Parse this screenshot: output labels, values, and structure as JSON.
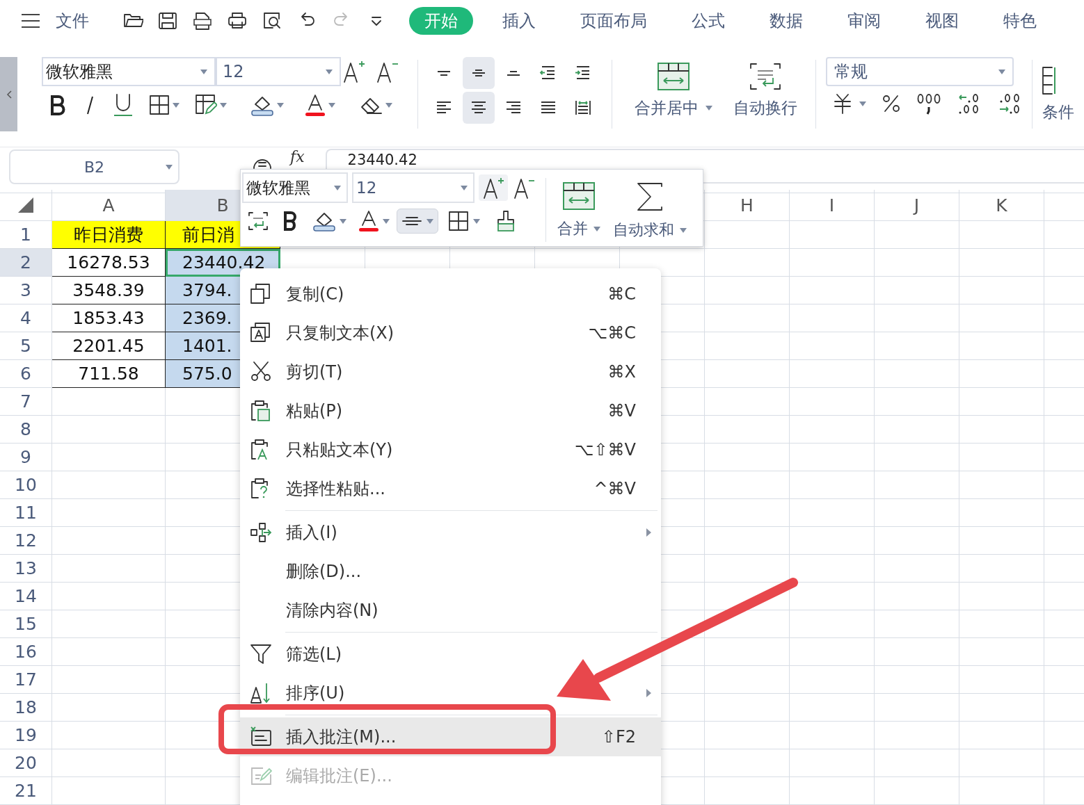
{
  "menu_bar": {
    "file_label": "文件",
    "tabs": [
      {
        "label": "开始",
        "selected": true
      },
      {
        "label": "插入",
        "selected": false
      },
      {
        "label": "页面布局",
        "selected": false
      },
      {
        "label": "公式",
        "selected": false
      },
      {
        "label": "数据",
        "selected": false
      },
      {
        "label": "审阅",
        "selected": false
      },
      {
        "label": "视图",
        "selected": false
      },
      {
        "label": "特色",
        "selected": false
      }
    ]
  },
  "ribbon": {
    "font_name": "微软雅黑",
    "font_size": "12",
    "align_buttons": [
      {
        "kind": "top",
        "selected": false
      },
      {
        "kind": "middle",
        "selected": true
      },
      {
        "kind": "bottom",
        "selected": false
      },
      {
        "kind": "outdent",
        "selected": false
      },
      {
        "kind": "indent",
        "selected": false
      },
      {
        "kind": "left",
        "selected": false
      },
      {
        "kind": "center",
        "selected": true
      },
      {
        "kind": "right",
        "selected": false
      },
      {
        "kind": "justify",
        "selected": false
      },
      {
        "kind": "distribute",
        "selected": false
      }
    ],
    "merge_label": "合并居中",
    "wrap_label": "自动换行",
    "number_format": "常规",
    "conditional_label": "条件"
  },
  "formula_bar": {
    "cell_ref": "B2",
    "fx_label": "fx",
    "value": "23440.42"
  },
  "sheet": {
    "columns": [
      {
        "label": "A",
        "selected": false
      },
      {
        "label": "B",
        "selected": true
      },
      {
        "label": "H",
        "selected": false
      },
      {
        "label": "I",
        "selected": false
      },
      {
        "label": "J",
        "selected": false
      },
      {
        "label": "K",
        "selected": false
      }
    ],
    "rows": [
      {
        "label": "1",
        "selected": false,
        "cells": [
          {
            "text": "昨日消费",
            "highlighted": true,
            "selected": false
          },
          {
            "text": "前日消",
            "highlighted": true,
            "selected": false
          }
        ]
      },
      {
        "label": "2",
        "selected": true,
        "cells": [
          {
            "text": "16278.53",
            "highlighted": false,
            "selected": false
          },
          {
            "text": "23440.42",
            "highlighted": false,
            "selected": true
          }
        ]
      },
      {
        "label": "3",
        "selected": false,
        "cells": [
          {
            "text": "3548.39",
            "highlighted": false,
            "selected": false
          },
          {
            "text": "3794.",
            "highlighted": false,
            "selected": true
          }
        ]
      },
      {
        "label": "4",
        "selected": false,
        "cells": [
          {
            "text": "1853.43",
            "highlighted": false,
            "selected": false
          },
          {
            "text": "2369.",
            "highlighted": false,
            "selected": true
          }
        ]
      },
      {
        "label": "5",
        "selected": false,
        "cells": [
          {
            "text": "2201.45",
            "highlighted": false,
            "selected": false
          },
          {
            "text": "1401.",
            "highlighted": false,
            "selected": true
          }
        ]
      },
      {
        "label": "6",
        "selected": false,
        "cells": [
          {
            "text": "711.58",
            "highlighted": false,
            "selected": false
          },
          {
            "text": "575.0",
            "highlighted": false,
            "selected": true
          }
        ]
      },
      {
        "label": "7",
        "selected": false
      },
      {
        "label": "8",
        "selected": false
      },
      {
        "label": "9",
        "selected": false
      },
      {
        "label": "10",
        "selected": false
      },
      {
        "label": "11",
        "selected": false
      },
      {
        "label": "12",
        "selected": false
      },
      {
        "label": "13",
        "selected": false
      },
      {
        "label": "14",
        "selected": false
      },
      {
        "label": "15",
        "selected": false
      },
      {
        "label": "16",
        "selected": false
      },
      {
        "label": "17",
        "selected": false
      },
      {
        "label": "18",
        "selected": false
      },
      {
        "label": "19",
        "selected": false
      },
      {
        "label": "20",
        "selected": false
      },
      {
        "label": "21",
        "selected": false
      }
    ]
  },
  "mini_toolbar": {
    "font_name": "微软雅黑",
    "font_size": "12",
    "align_selected": true,
    "merge_label": "合并",
    "sum_label": "自动求和"
  },
  "context_menu": {
    "items": [
      {
        "kind": "item",
        "label": "复制(C)",
        "shortcut": "⌘C",
        "submenu": false,
        "selected": false,
        "disabled": false
      },
      {
        "kind": "item",
        "label": "只复制文本(X)",
        "shortcut": "⌥⌘C",
        "submenu": false,
        "selected": false,
        "disabled": false
      },
      {
        "kind": "item",
        "label": "剪切(T)",
        "shortcut": "⌘X",
        "submenu": false,
        "selected": false,
        "disabled": false
      },
      {
        "kind": "item",
        "label": "粘贴(P)",
        "shortcut": "⌘V",
        "submenu": false,
        "selected": false,
        "disabled": false
      },
      {
        "kind": "item",
        "label": "只粘贴文本(Y)",
        "shortcut": "⌥⇧⌘V",
        "submenu": false,
        "selected": false,
        "disabled": false
      },
      {
        "kind": "item",
        "label": "选择性粘贴...",
        "shortcut": "^⌘V",
        "submenu": false,
        "selected": false,
        "disabled": false
      },
      {
        "kind": "separator"
      },
      {
        "kind": "item",
        "label": "插入(I)",
        "submenu": true,
        "selected": false,
        "disabled": false
      },
      {
        "kind": "item",
        "label": "删除(D)...",
        "submenu": false,
        "selected": false,
        "disabled": false
      },
      {
        "kind": "item",
        "label": "清除内容(N)",
        "submenu": false,
        "selected": false,
        "disabled": false
      },
      {
        "kind": "separator"
      },
      {
        "kind": "item",
        "label": "筛选(L)",
        "submenu": false,
        "selected": false,
        "disabled": false
      },
      {
        "kind": "item",
        "label": "排序(U)",
        "submenu": true,
        "selected": false,
        "disabled": false
      },
      {
        "kind": "separator"
      },
      {
        "kind": "item",
        "label": "插入批注(M)...",
        "shortcut": "⇧F2",
        "submenu": false,
        "selected": true,
        "disabled": false
      },
      {
        "kind": "item",
        "label": "编辑批注(E)...",
        "submenu": false,
        "selected": false,
        "disabled": true
      }
    ]
  }
}
